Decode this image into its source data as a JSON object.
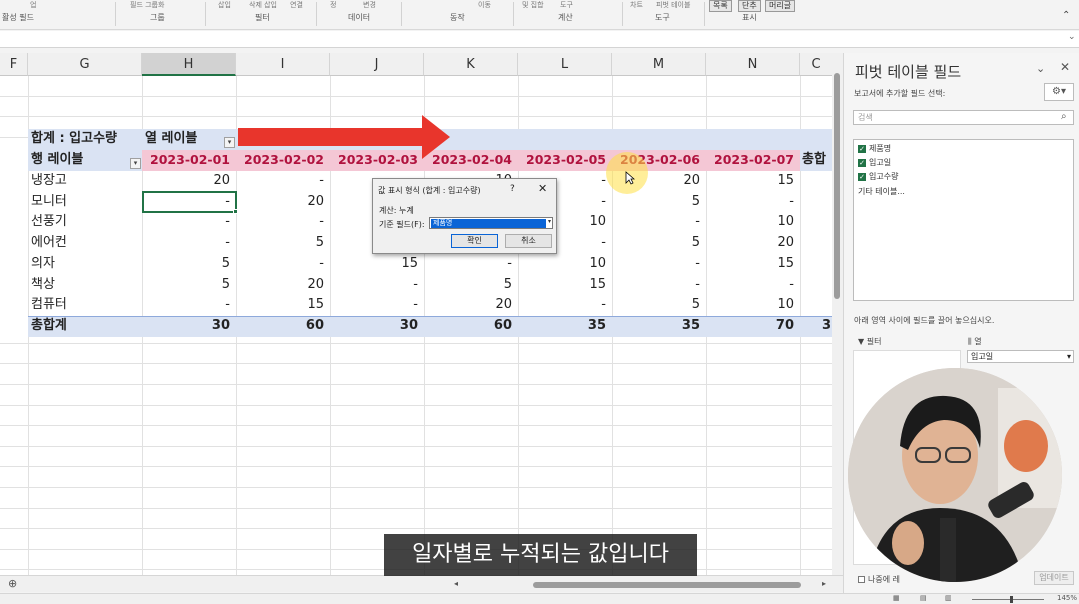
{
  "ribbon": {
    "top_labels": [
      "업",
      "필드 그룹화",
      "삽입",
      "삭제 삽입",
      "연결",
      "정",
      "변경",
      "이동",
      "및 집합",
      "도구",
      "차트",
      "피벗 테이블"
    ],
    "group_labels": [
      "활성 필드",
      "그룹",
      "필터",
      "데이터",
      "동작",
      "계산",
      "도구",
      "표시"
    ],
    "buttons": [
      "목록",
      "단추",
      "머리글"
    ]
  },
  "columns": [
    "F",
    "G",
    "H",
    "I",
    "J",
    "K",
    "L",
    "M",
    "N",
    "C"
  ],
  "pivot": {
    "sum_label": "합계 : 입고수량",
    "col_label": "열 레이블",
    "row_label": "행 레이블",
    "dates": [
      "2023-02-01",
      "2023-02-02",
      "2023-02-03",
      "2023-02-04",
      "2023-02-05",
      "2023-02-06",
      "2023-02-07"
    ],
    "grand_col_label": "총합",
    "rows": [
      {
        "name": "냉장고",
        "values": [
          "20",
          "-",
          "",
          "10",
          "-",
          "20",
          "15"
        ]
      },
      {
        "name": "모니터",
        "values": [
          "-",
          "20",
          "",
          "",
          "-",
          "5",
          "-"
        ]
      },
      {
        "name": "선풍기",
        "values": [
          "-",
          "-",
          "",
          "",
          "10",
          "-",
          "10"
        ]
      },
      {
        "name": "에어컨",
        "values": [
          "-",
          "5",
          "",
          "",
          "-",
          "5",
          "20"
        ]
      },
      {
        "name": "의자",
        "values": [
          "5",
          "-",
          "15",
          "-",
          "10",
          "-",
          "15"
        ]
      },
      {
        "name": "책상",
        "values": [
          "5",
          "20",
          "-",
          "5",
          "15",
          "-",
          "-"
        ]
      },
      {
        "name": "컴퓨터",
        "values": [
          "-",
          "15",
          "-",
          "20",
          "-",
          "5",
          "10"
        ]
      }
    ],
    "total": {
      "name": "총합계",
      "values": [
        "30",
        "60",
        "30",
        "60",
        "35",
        "35",
        "70"
      ],
      "grand": "3"
    }
  },
  "dialog": {
    "title": "값 표시 형식 (합계 : 입고수량)",
    "help": "?",
    "close": "✕",
    "calc_label": "계산: 누계",
    "base_field_label": "기준 필드(F):",
    "base_field_value": "제품명",
    "ok": "확인",
    "cancel": "취소"
  },
  "pane": {
    "title": "피벗 테이블 필드",
    "subtitle": "보고서에 추가할 필드 선택:",
    "search_placeholder": "검색",
    "fields": [
      "제품명",
      "입고일",
      "입고수량"
    ],
    "more_tables": "기타 테이블...",
    "areas_hint": "아래 영역 사이에 필드를 끌어 놓으십시오.",
    "filter_label": "필터",
    "columns_label": "열",
    "columns_value": "입고일",
    "defer_label": "나중에 레",
    "update_label": "업데이트"
  },
  "status": {
    "zoom": "145%"
  },
  "caption": "일자별로 누적되는 값입니다",
  "colors": {
    "accent": "#217346",
    "header_band": "#dae3f3",
    "pink_band": "#f4c7d5",
    "date_text": "#b0123e",
    "arrow": "#e8352c"
  }
}
